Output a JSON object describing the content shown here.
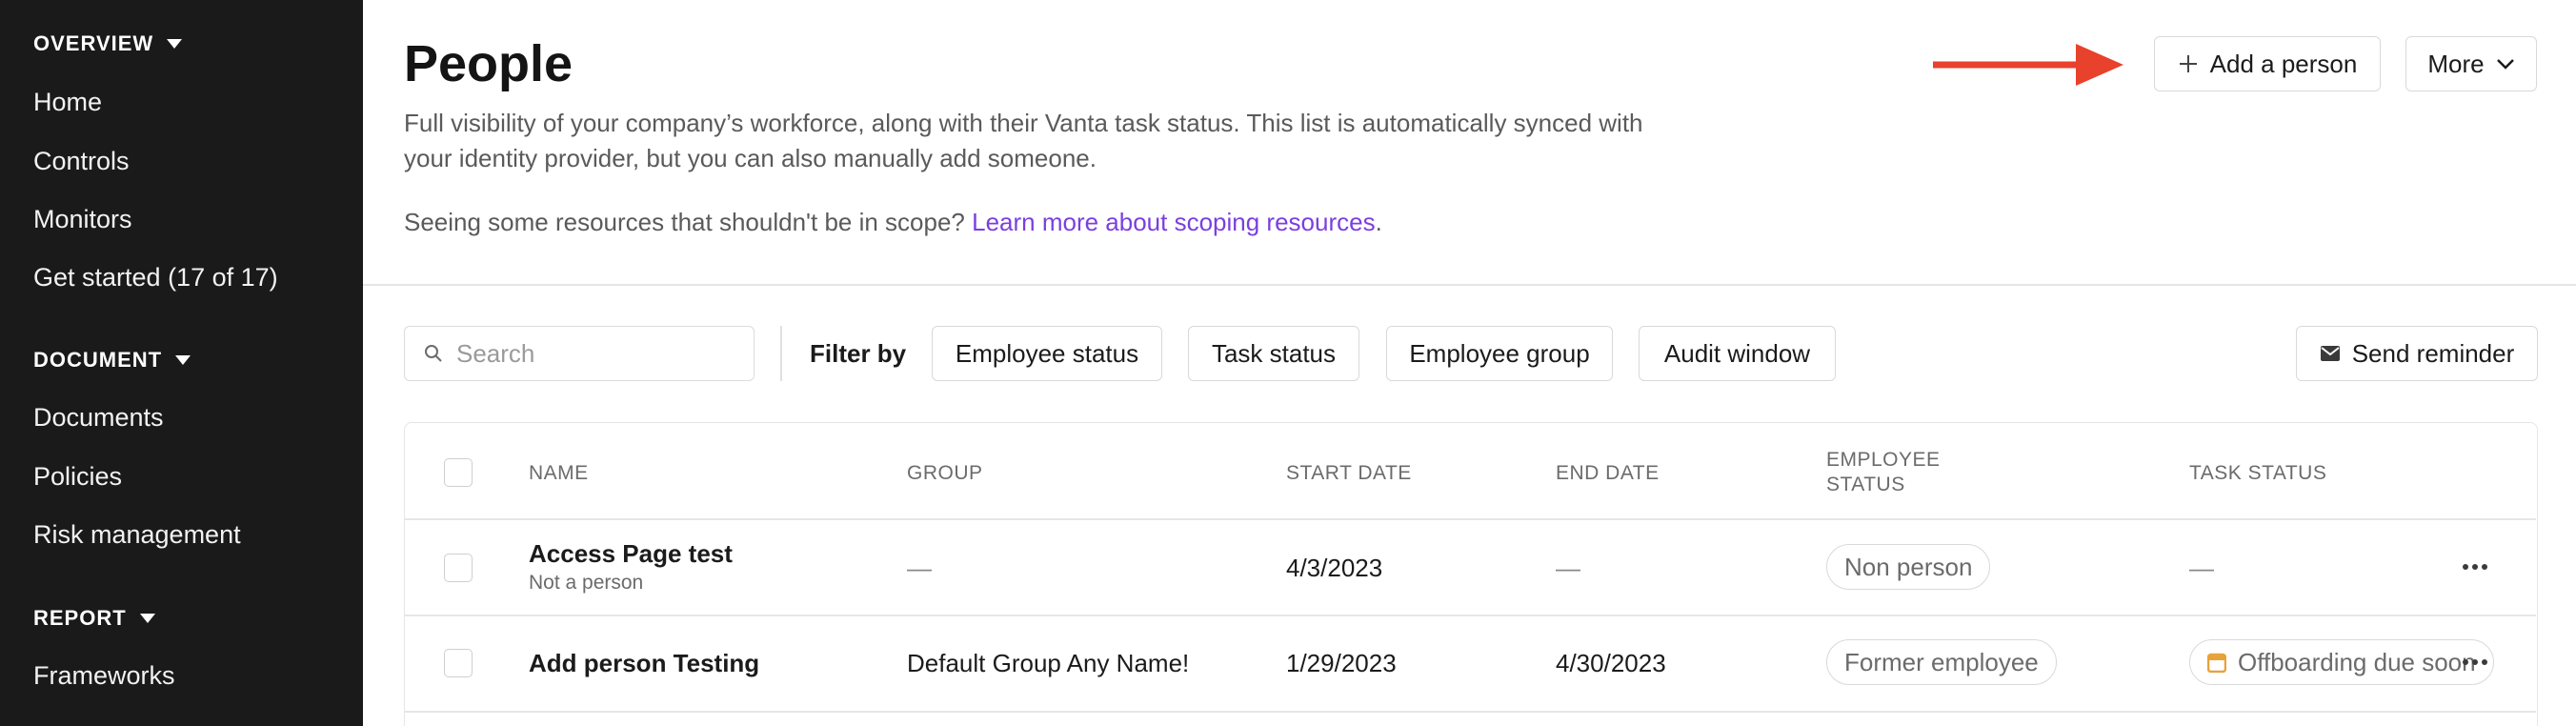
{
  "sidebar": {
    "sections": [
      {
        "label": "OVERVIEW",
        "items": [
          {
            "label": "Home"
          },
          {
            "label": "Controls"
          },
          {
            "label": "Monitors"
          },
          {
            "label": "Get started  (17 of 17)"
          }
        ]
      },
      {
        "label": "DOCUMENT",
        "items": [
          {
            "label": "Documents"
          },
          {
            "label": "Policies"
          },
          {
            "label": "Risk management"
          }
        ]
      },
      {
        "label": "REPORT",
        "items": [
          {
            "label": "Frameworks"
          }
        ]
      }
    ]
  },
  "header": {
    "title": "People",
    "description": "Full visibility of your company’s workforce, along with their Vanta task status. This list is automatically synced with your identity provider, but you can also manually add someone.",
    "scope_text": "Seeing some resources that shouldn't be in scope? ",
    "scope_link": "Learn more about scoping resources",
    "scope_end": ".",
    "add_person_label": "Add a person",
    "more_label": "More"
  },
  "filters": {
    "search_placeholder": "Search",
    "filter_by_label": "Filter by",
    "chips": [
      "Employee status",
      "Task status",
      "Employee group",
      "Audit window"
    ],
    "send_reminder_label": "Send reminder"
  },
  "table": {
    "columns": [
      "NAME",
      "GROUP",
      "START DATE",
      "END DATE",
      "EMPLOYEE STATUS",
      "TASK STATUS"
    ],
    "column_employee_status_line1": "EMPLOYEE",
    "column_employee_status_line2": "STATUS",
    "rows": [
      {
        "name": "Access Page test",
        "subtitle": "Not a person",
        "group": "—",
        "start_date": "4/3/2023",
        "end_date": "—",
        "employee_status": "Non person",
        "task_status": "—"
      },
      {
        "name": "Add person Testing",
        "subtitle": "",
        "group": "Default Group Any Name!",
        "start_date": "1/29/2023",
        "end_date": "4/30/2023",
        "employee_status": "Former employee",
        "task_status": "Offboarding due soon"
      }
    ]
  },
  "colors": {
    "sidebar_bg": "#1a1a1a",
    "link": "#7b3fe0",
    "arrow": "#e8412c",
    "offboarding_icon": "#e8a23a"
  },
  "icons": {
    "add": "plus-icon",
    "more": "chevron-down-icon",
    "search": "search-icon",
    "reminder": "mail-icon",
    "row_menu": "more-horizontal-icon",
    "task": "calendar-icon"
  }
}
